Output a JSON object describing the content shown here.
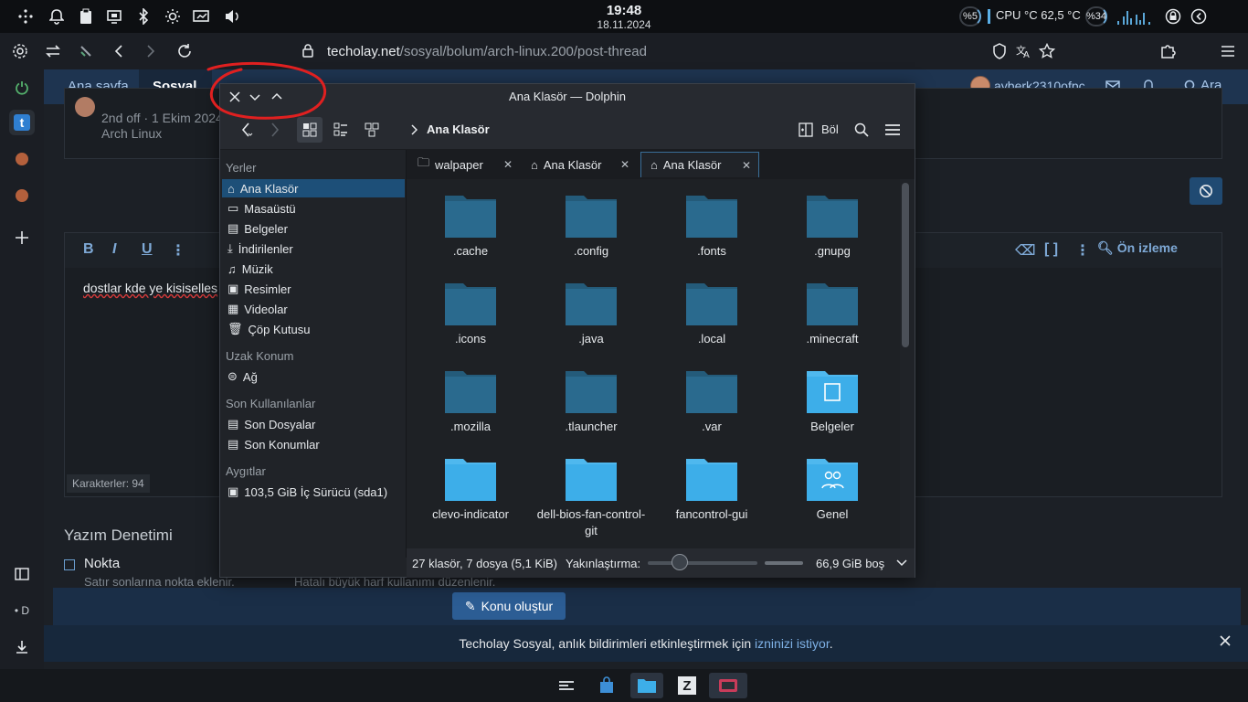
{
  "system_panel": {
    "time": "19:48",
    "date": "18.11.2024",
    "ram_percent": "%5",
    "cpu_label": "CPU °C 62,5 °C",
    "gpu_percent": "%34",
    "icons": [
      "network-icon",
      "bell-icon",
      "clipboard-icon",
      "display-icon",
      "bluetooth-icon",
      "brightness-icon",
      "monitor-icon",
      "volume-icon",
      "lock-icon",
      "power-icon"
    ]
  },
  "browser": {
    "url_host": "techolay.net",
    "url_path": "/sosyal/bolum/arch-linux.200/post-thread"
  },
  "site": {
    "nav": {
      "home": "Ana sayfa",
      "social": "Sosyal",
      "username": "ayberk2310ofpc",
      "search": "Ara"
    },
    "post": {
      "meta_line": "2nd off · 1 Ekim 2024",
      "forum": "Arch Linux"
    },
    "editor": {
      "bold": "B",
      "italic": "I",
      "underline": "U",
      "content": "dostlar kde ye kisiselles",
      "char_count": "Karakterler: 94",
      "preview": "Ön izleme"
    },
    "spellcheck": {
      "title": "Yazım Denetimi",
      "option_label": "Nokta",
      "option_desc": "Satır sonlarına nokta eklenir.",
      "option_desc2": "Hatalı büyük harf kullanımı düzenlenir."
    },
    "create_button": "Konu oluştur",
    "notification": {
      "text_before": "Techolay Sosyal, anlık bildirimleri etkinleştirmek için ",
      "link": "izninizi istiyor",
      "text_after": "."
    }
  },
  "dolphin": {
    "title": "Ana Klasör — Dolphin",
    "breadcrumb": "Ana Klasör",
    "split_button": "Böl",
    "places": {
      "section_places": "Yerler",
      "places_items": [
        "Ana Klasör",
        "Masaüstü",
        "Belgeler",
        "İndirilenler",
        "Müzik",
        "Resimler",
        "Videolar",
        "Çöp Kutusu"
      ],
      "section_remote": "Uzak Konum",
      "remote_items": [
        "Ağ"
      ],
      "section_recent": "Son Kullanılanlar",
      "recent_items": [
        "Son Dosyalar",
        "Son Konumlar"
      ],
      "section_devices": "Aygıtlar",
      "device_items": [
        "103,5 GiB İç Sürücü (sda1)"
      ]
    },
    "tabs": [
      "walpaper",
      "Ana Klasör",
      "Ana Klasör"
    ],
    "active_tab_index": 2,
    "files": [
      {
        "name": ".cache",
        "hidden": true
      },
      {
        "name": ".config",
        "hidden": true
      },
      {
        "name": ".fonts",
        "hidden": true
      },
      {
        "name": ".gnupg",
        "hidden": true
      },
      {
        "name": ".icons",
        "hidden": true
      },
      {
        "name": ".java",
        "hidden": true
      },
      {
        "name": ".local",
        "hidden": true
      },
      {
        "name": ".minecraft",
        "hidden": true
      },
      {
        "name": ".mozilla",
        "hidden": true
      },
      {
        "name": ".tlauncher",
        "hidden": true
      },
      {
        "name": ".var",
        "hidden": true
      },
      {
        "name": "Belgeler",
        "hidden": false,
        "badge": "document"
      },
      {
        "name": "clevo-indicator",
        "hidden": false
      },
      {
        "name": "dell-bios-fan-control-git",
        "hidden": false
      },
      {
        "name": "fancontrol-gui",
        "hidden": false
      },
      {
        "name": "Genel",
        "hidden": false,
        "badge": "people"
      }
    ],
    "status": {
      "count": "27 klasör, 7 dosya (5,1 KiB)",
      "zoom_label": "Yakınlaştırma:",
      "free_space": "66,9 GiB boş"
    }
  },
  "colors": {
    "folder_hidden": "#2a6a8e",
    "folder_normal": "#3daee9",
    "accent": "#1d4f78",
    "annotation": "#e02020"
  }
}
